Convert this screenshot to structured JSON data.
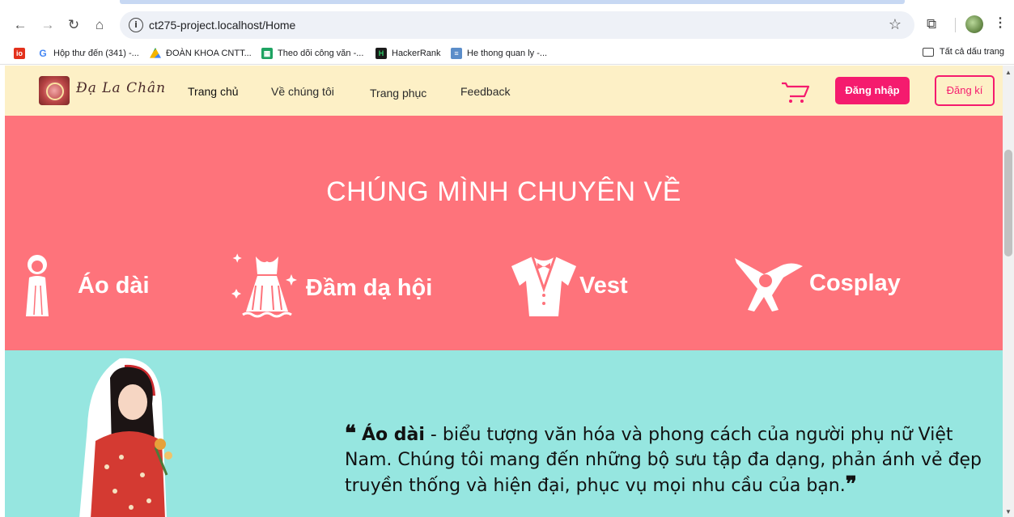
{
  "browser": {
    "url": "ct275-project.localhost/Home",
    "bookmarks": [
      {
        "icon": "outlook-icon",
        "label": ""
      },
      {
        "icon": "google-icon",
        "label": "Hộp thư đến (341) -..."
      },
      {
        "icon": "drive-icon",
        "label": "ĐOÀN KHOA CNTT..."
      },
      {
        "icon": "sheets-icon",
        "label": "Theo dõi công văn -..."
      },
      {
        "icon": "hackerrank-icon",
        "label": "HackerRank"
      },
      {
        "icon": "system-icon",
        "label": "He thong quan ly -..."
      }
    ],
    "all_bookmarks": "Tất cả dấu trang"
  },
  "site": {
    "logo_text": "Đạ La Chân",
    "nav": [
      "Trang chủ",
      "Về chúng tôi",
      "Trang phục",
      "Feedback"
    ],
    "login": "Đăng nhập",
    "register": "Đăng kí",
    "hero_title": "CHÚNG MÌNH CHUYÊN VỀ",
    "categories": [
      "Áo dài",
      "Đầm dạ hội",
      "Vest",
      "Cosplay"
    ],
    "about": {
      "highlight": "Áo dài",
      "text": " - biểu tượng văn hóa và phong cách của người phụ nữ Việt Nam. Chúng tôi mang đến những bộ sưu tập đa dạng, phản ánh vẻ đẹp truyền thống và hiện đại, phục vụ mọi nhu cầu của bạn."
    }
  },
  "colors": {
    "nav_bg": "#fdf0c6",
    "hero_bg": "#fe737b",
    "about_bg": "#96e6e0",
    "accent_pink": "#f51b6e"
  }
}
